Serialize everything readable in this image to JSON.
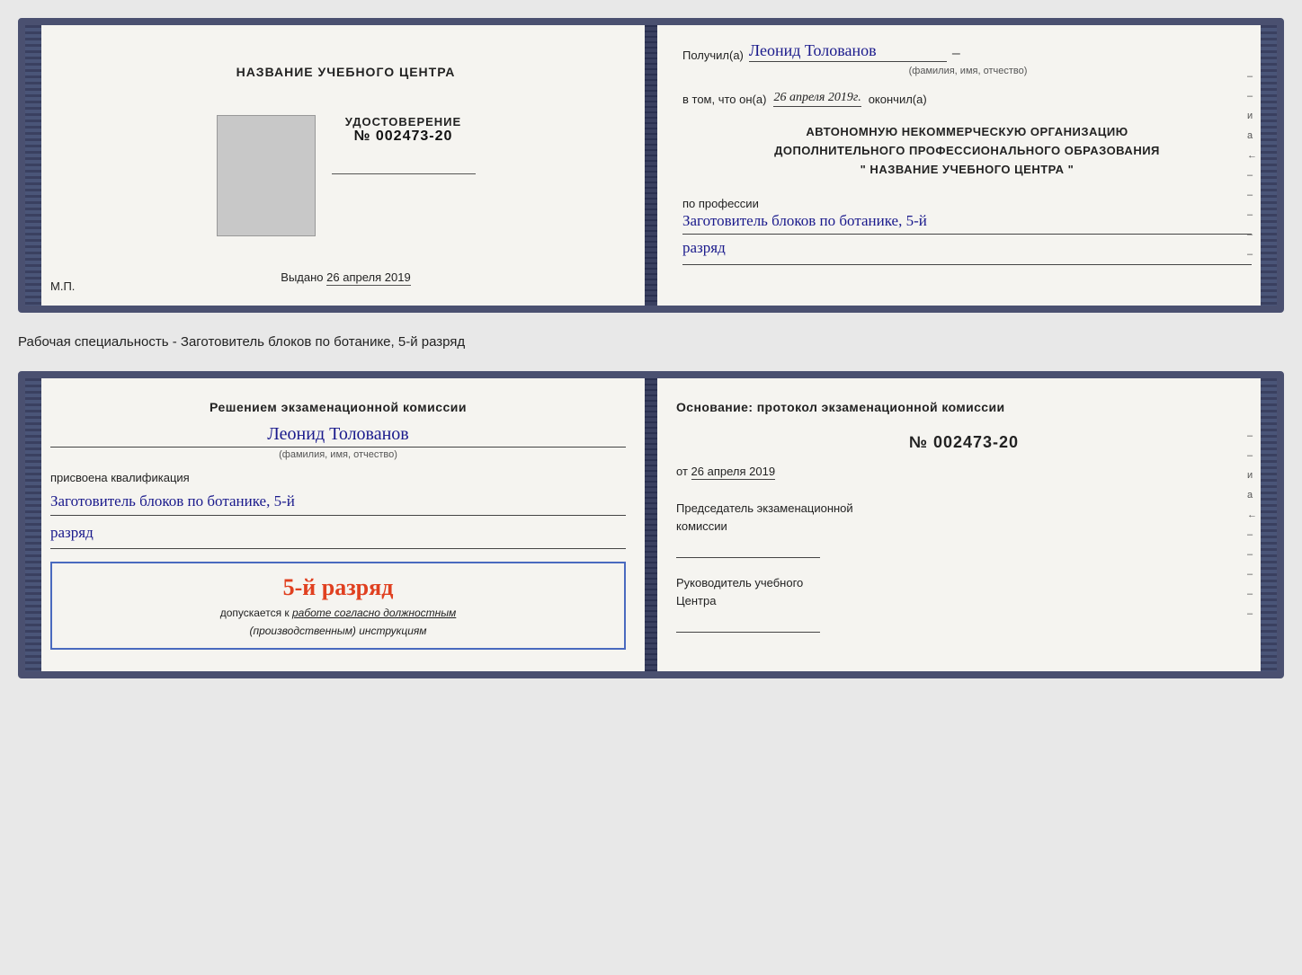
{
  "card_top": {
    "left": {
      "title": "НАЗВАНИЕ УЧЕБНОГО ЦЕНТРА",
      "cert_label": "УДОСТОВЕРЕНИЕ",
      "cert_number": "№ 002473-20",
      "issued_prefix": "Выдано",
      "issued_date": "26 апреля 2019",
      "mp_label": "М.П."
    },
    "right": {
      "recipient_label": "Получил(а)",
      "recipient_name": "Леонид Толованов",
      "recipient_subtext": "(фамилия, имя, отчество)",
      "date_prefix": "в том, что он(а)",
      "date_value": "26 апреля 2019г.",
      "date_suffix": "окончил(а)",
      "org_line1": "АВТОНОМНУЮ НЕКОММЕРЧЕСКУЮ ОРГАНИЗАЦИЮ",
      "org_line2": "ДОПОЛНИТЕЛЬНОГО ПРОФЕССИОНАЛЬНОГО ОБРАЗОВАНИЯ",
      "org_line3": "\"   НАЗВАНИЕ УЧЕБНОГО ЦЕНТРА   \"",
      "profession_prefix": "по профессии",
      "profession_value": "Заготовитель блоков по ботанике, 5-й",
      "rank_value": "разряд"
    }
  },
  "specialty_line": "Рабочая специальность - Заготовитель блоков по ботанике, 5-й разряд",
  "card_bottom": {
    "left": {
      "decision_label": "Решением экзаменационной комиссии",
      "person_name": "Леонид Толованов",
      "person_subtext": "(фамилия, имя, отчество)",
      "qualification_prefix": "присвоена квалификация",
      "qualification_value": "Заготовитель блоков по ботанике, 5-й",
      "rank_value": "разряд",
      "stamp_rank": "5-й разряд",
      "stamp_admission_prefix": "допускается к",
      "stamp_admission_value": "работе согласно должностным",
      "stamp_instructions": "(производственным) инструкциям"
    },
    "right": {
      "basis_label": "Основание: протокол экзаменационной комиссии",
      "protocol_number": "№ 002473-20",
      "from_prefix": "от",
      "from_date": "26 апреля 2019",
      "chairman_label": "Председатель экзаменационной",
      "chairman_label2": "комиссии",
      "director_label": "Руководитель учебного",
      "director_label2": "Центра"
    }
  },
  "side_marks": {
    "marks": [
      "–",
      "–",
      "и",
      "а",
      "←",
      "–",
      "–",
      "–",
      "–",
      "–"
    ]
  }
}
